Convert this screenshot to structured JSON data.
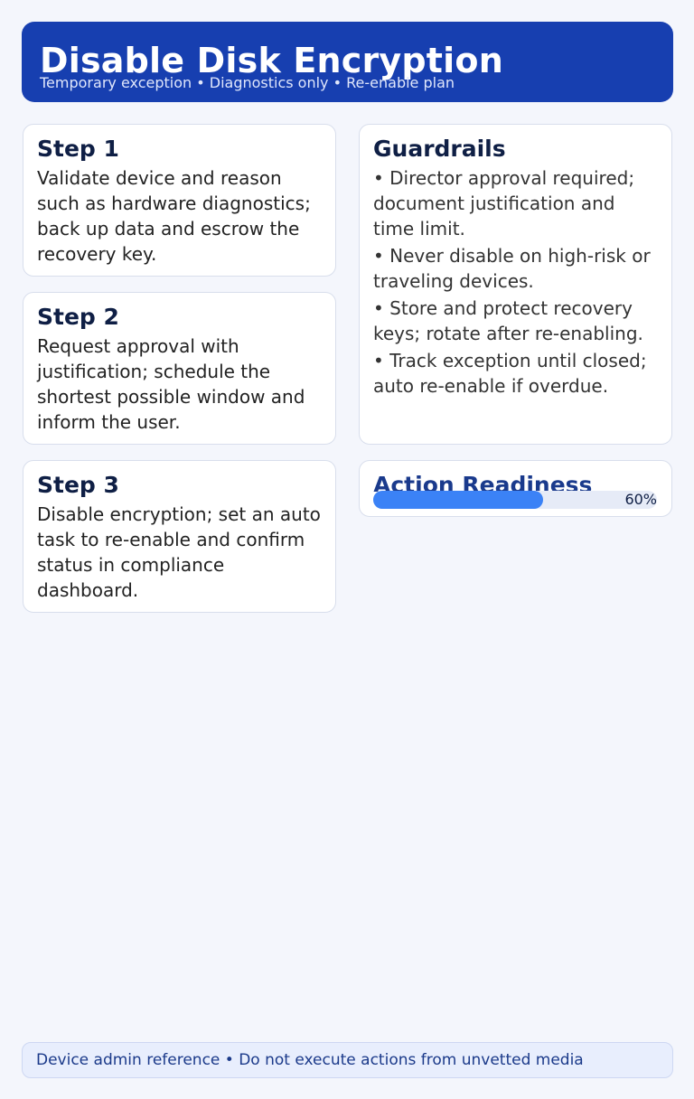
{
  "header": {
    "title": "Disable Disk Encryption",
    "subtitle": "Temporary exception • Diagnostics only • Re-enable plan"
  },
  "steps": [
    {
      "title": "Step 1",
      "body": "Validate device and reason such as hardware diagnostics; back up data and escrow the recovery key."
    },
    {
      "title": "Step 2",
      "body": "Request approval with justification; schedule the shortest possible window and inform the user."
    },
    {
      "title": "Step 3",
      "body": "Disable encryption; set an auto task to re-enable and confirm status in compliance dashboard."
    }
  ],
  "guardrails": {
    "title": "Guardrails",
    "items": [
      "Director approval required; document justification and time limit.",
      "Never disable on high-risk or traveling devices.",
      "Store and protect recovery keys; rotate after re-enabling.",
      "Track exception until closed; auto re-enable if overdue."
    ]
  },
  "readiness": {
    "title": "Action Readiness",
    "percent_label": "60%",
    "percent": 60,
    "fill_color": "#3b82f6"
  },
  "footer": {
    "text": "Device admin reference • Do not execute actions from unvetted media"
  },
  "colors": {
    "header_bg": "#173fb0",
    "page_bg": "#f4f6fc",
    "accent": "#3b82f6"
  }
}
